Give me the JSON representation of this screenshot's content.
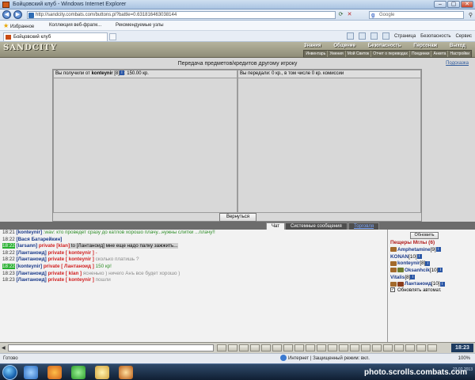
{
  "window": {
    "title": "Бойцовский клуб - Windows Internet Explorer"
  },
  "browser": {
    "address": "http://sandcity.combats.com/buttons.pl?battle=0.631816463038144",
    "address_host": "combats.com",
    "search_placeholder": "Google",
    "favorites_label": "Избранное",
    "fav_items": [
      "Коллекция веб-фрагм...",
      "Рекомендуемые узлы"
    ],
    "tab_title": "Бойцовский клуб",
    "commands": [
      "Страница",
      "Безопасность",
      "Сервис"
    ]
  },
  "game": {
    "logo": "SANDCITY",
    "menu_top": [
      "Знания",
      "Общение",
      "Безопасность",
      "Персонаж",
      "Выход"
    ],
    "menu_sub": [
      "Инвентарь",
      "Умения",
      "Мой Свиток",
      "Отчет о переводах",
      "Поединки",
      "Анкета",
      "Настройки"
    ]
  },
  "trade": {
    "title": "Передача предметов/кредитов другому игроку",
    "hint": "Подсказка",
    "received_prefix": "Вы получили от",
    "received_user": "konteynir",
    "received_level": "[8]",
    "received_amount": ": 150.00 кр.",
    "given": "Вы передали: 0 кр., в том числе 0 кр. комиссии",
    "back_button": "Вернуться",
    "info_glyph": "i"
  },
  "chat_tabs": [
    "Чат",
    "Системные сообщения",
    "Торговля"
  ],
  "chat": [
    {
      "time": "18:21",
      "nick": "[konteynir]",
      "text": " :wav: кто проведет сразу до катлов хорошо плачу...нужны слитки ...плачу!!"
    },
    {
      "time": "18:22",
      "nick": "[Вася Батарейкин]",
      "text": ""
    },
    {
      "time": "18:22",
      "nick": "[larsann]",
      "private": "private [klan]",
      "text": " to [Лантаноид] мне еще надо палку зажжить..."
    },
    {
      "time": "18:22",
      "nick": "[Лантаноид]",
      "private": "private [ konteynir ]",
      "text": " -"
    },
    {
      "time": "18:22",
      "nick": "[Лантаноид]",
      "private": "private [ konteynir ]",
      "text": " сколько платишь ?"
    },
    {
      "time": "18:22",
      "nick": "[konteynir]",
      "private": "private [ Лантаноид ]",
      "text": " 150 кр!"
    },
    {
      "time": "18:23",
      "nick": "[Лантаноид]",
      "private": "private [ klan ]",
      "text": " ясненько ) ничего Анъ все будет хорошо )"
    },
    {
      "time": "18:23",
      "nick": "[Лантаноид]",
      "private": "private [ konteynir ]",
      "text": " пошли"
    }
  ],
  "side": {
    "refresh": "Обновить",
    "room": "Пещеры Мглы (6)",
    "users": [
      {
        "name": "Amphetamine",
        "level": "[9]"
      },
      {
        "name": "KONAN",
        "level": "[10]"
      },
      {
        "name": "konteynir",
        "level": "[8]"
      },
      {
        "name": "Oksanhcik",
        "level": "[10]"
      },
      {
        "name": "Vitalis",
        "level": "[8]"
      },
      {
        "name": "Лантаноид",
        "level": "[10]"
      }
    ],
    "auto_label": "Обновлять автомат.",
    "check_mark": "✓"
  },
  "toolbar": {
    "clock": "18:23"
  },
  "status": {
    "left": "Готово",
    "zone": "Интернет | Защищенный режим: вкл.",
    "zoom": "100%"
  },
  "taskbar": {
    "watermark": "photo.scrolls.combats.com",
    "date": "23.02.2013"
  }
}
